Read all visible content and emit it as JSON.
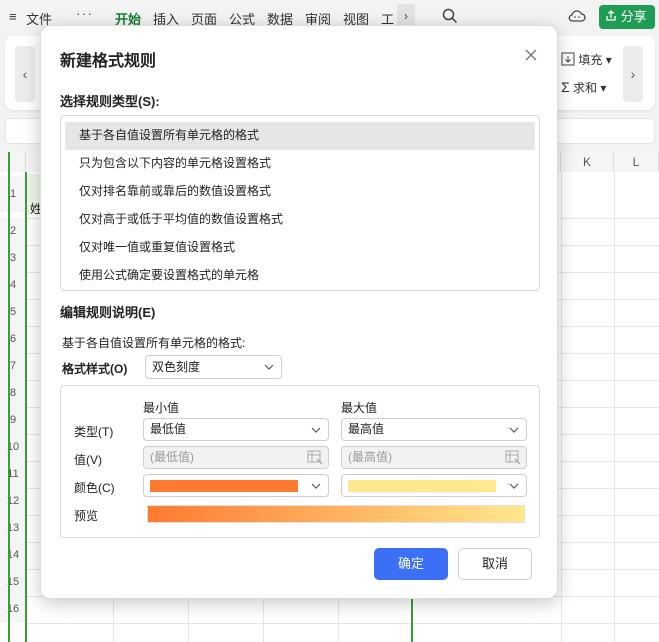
{
  "app": {
    "menu_icon": "≡",
    "menu": [
      "文件",
      "开始",
      "插入",
      "页面",
      "公式",
      "数据",
      "审阅",
      "视图",
      "工"
    ],
    "active_menu": "开始",
    "more_label": "···",
    "share_label": "分享",
    "ribbon": {
      "fill_label": "填充",
      "sum_label": "求和"
    },
    "columns": [
      "K",
      "L"
    ],
    "rows": [
      "1",
      "2",
      "3",
      "4",
      "5",
      "6",
      "7",
      "8",
      "9",
      "10",
      "11",
      "12",
      "13",
      "14",
      "15",
      "16"
    ],
    "cell_a1_partial": "姓",
    "accent_green": "#1f9d55"
  },
  "dialog": {
    "title": "新建格式规则",
    "rule_type_label": "选择规则类型(S):",
    "rule_types": [
      "基于各自值设置所有单元格的格式",
      "只为包含以下内容的单元格设置格式",
      "仅对排名靠前或靠后的数值设置格式",
      "仅对高于或低于平均值的数值设置格式",
      "仅对唯一值或重复值设置格式",
      "使用公式确定要设置格式的单元格"
    ],
    "selected_rule_index": 0,
    "edit_label": "编辑规则说明(E)",
    "description": "基于各自值设置所有单元格的格式:",
    "format_style_label": "格式样式(O)",
    "format_style_value": "双色刻度",
    "min_header": "最小值",
    "max_header": "最大值",
    "type_label": "类型(T)",
    "value_label": "值(V)",
    "color_label": "颜色(C)",
    "preview_label": "预览",
    "min_type": "最低值",
    "max_type": "最高值",
    "min_value": "(最低值)",
    "max_value": "(最高值)",
    "min_color": "#ff7a2f",
    "max_color": "#ffe88f",
    "ok_label": "确定",
    "cancel_label": "取消",
    "accent_blue": "#3b6ff5"
  }
}
